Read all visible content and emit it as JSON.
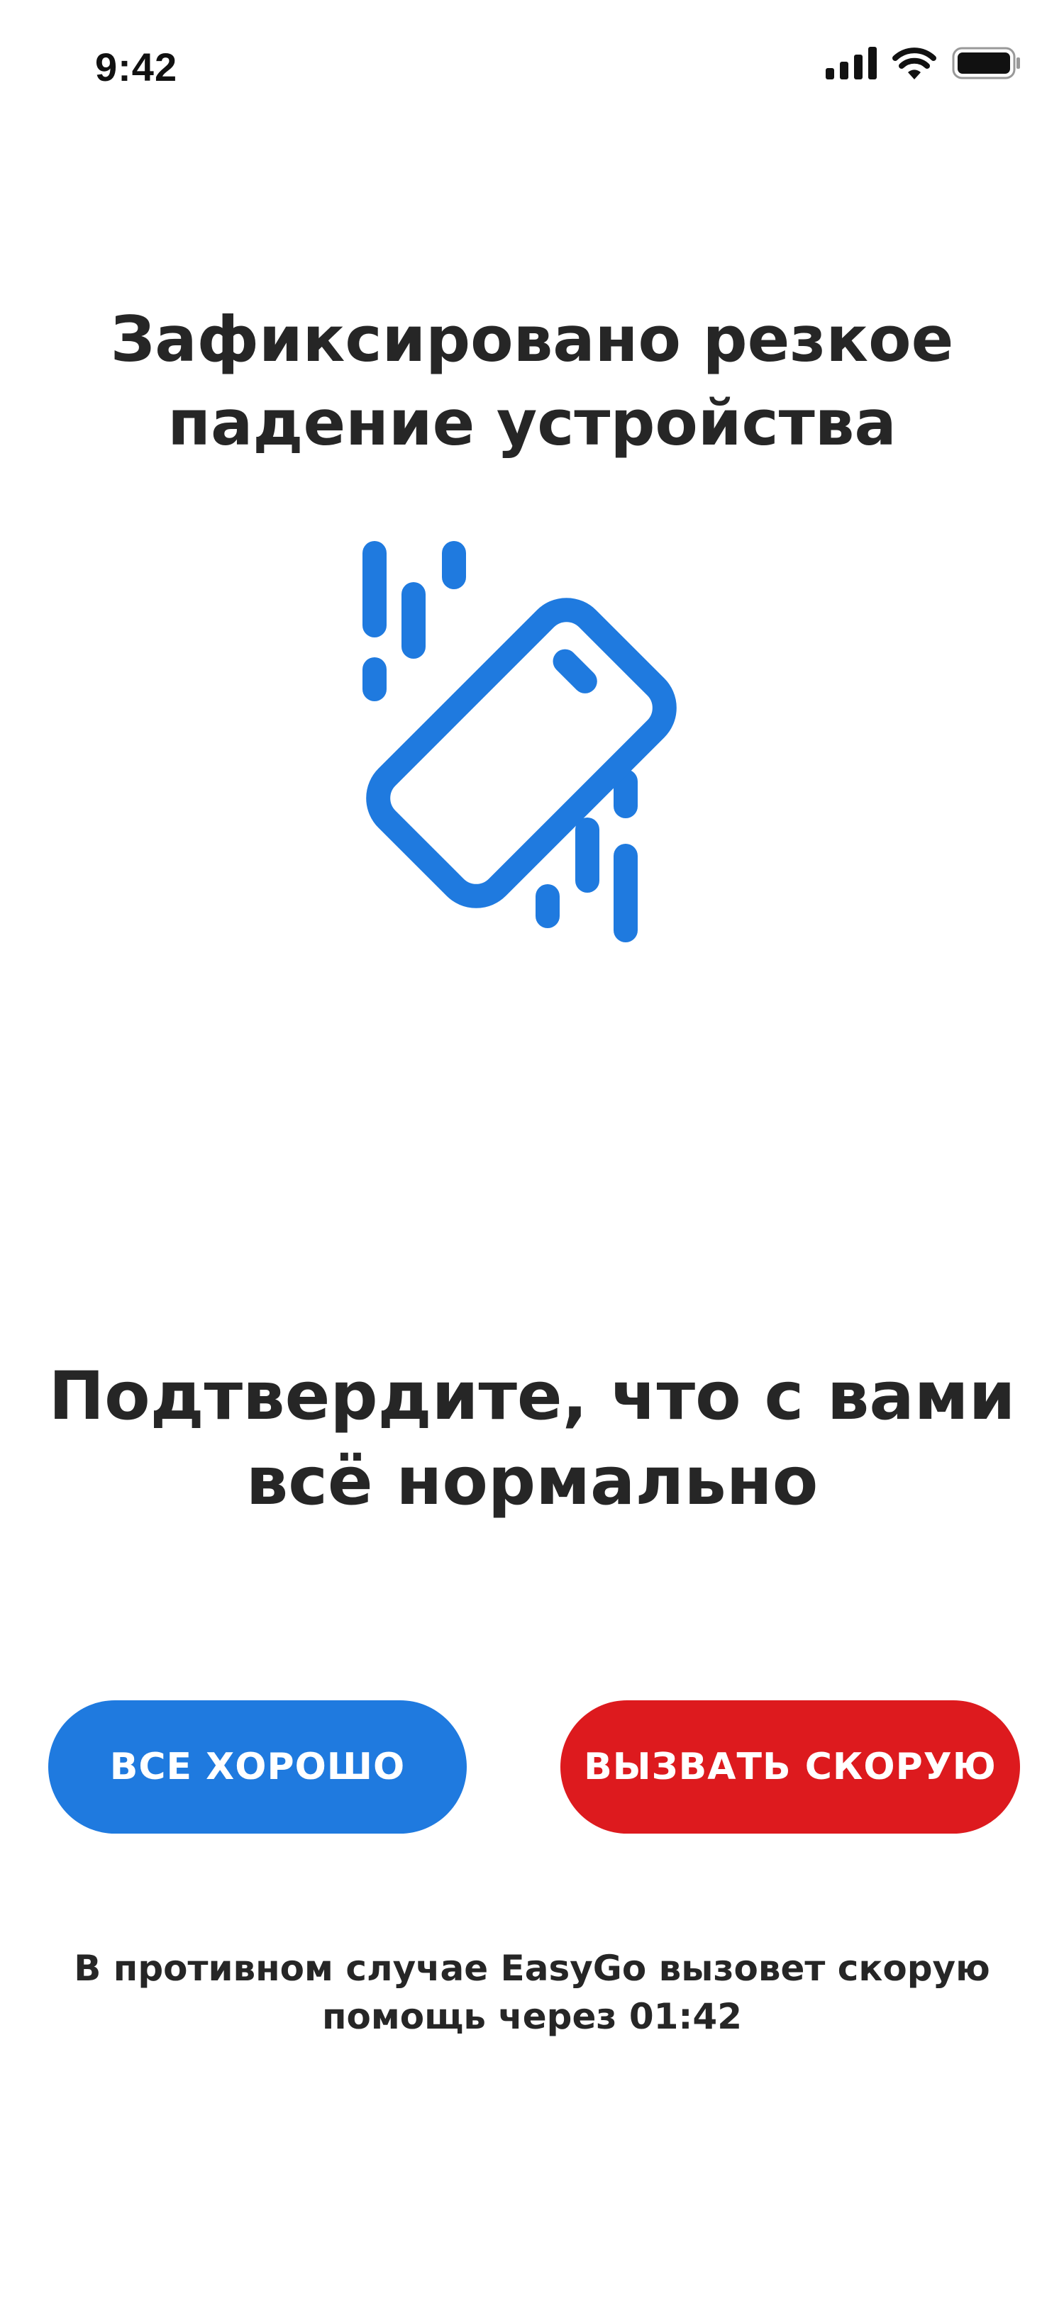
{
  "status_bar": {
    "time": "9:42",
    "icons": [
      "cellular-signal-icon",
      "wifi-icon",
      "battery-icon"
    ]
  },
  "alert": {
    "title_line1": "Зафиксировано резкое",
    "title_line2": "падение устройства",
    "illustration_icon": "falling-phone-icon"
  },
  "confirm": {
    "prompt_line1": "Подтвердите, что с вами",
    "prompt_line2": "всё нормально"
  },
  "actions": {
    "ok_label": "ВСЕ ХОРОШО",
    "ambulance_label": "ВЫЗВАТЬ СКОРУЮ"
  },
  "notice": {
    "line1": "В противном случае EasyGo вызовет скорую",
    "line2_prefix": "помощь через ",
    "timer": "01:42"
  },
  "colors": {
    "accent_blue": "#1f7adf",
    "danger_red": "#dd1a1e",
    "text": "#262626"
  }
}
